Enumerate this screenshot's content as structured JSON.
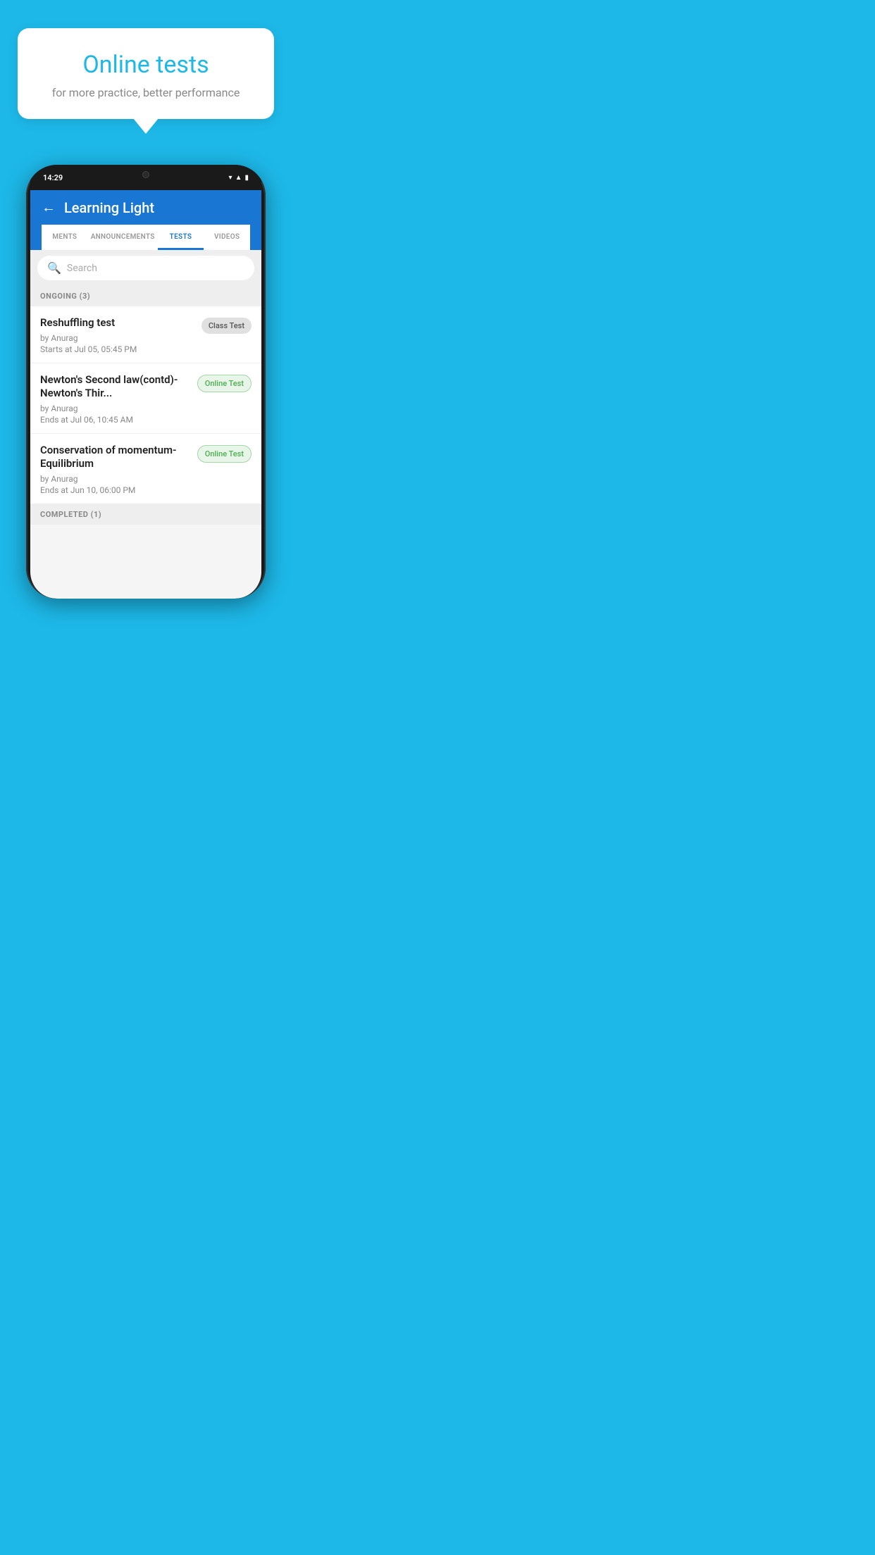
{
  "background_color": "#1DB8E8",
  "bubble": {
    "title": "Online tests",
    "subtitle": "for more practice, better performance"
  },
  "phone": {
    "status_bar": {
      "time": "14:29",
      "icons": [
        "wifi",
        "signal",
        "battery"
      ]
    },
    "header": {
      "title": "Learning Light",
      "back_label": "←"
    },
    "tabs": [
      {
        "label": "MENTS",
        "active": false
      },
      {
        "label": "ANNOUNCEMENTS",
        "active": false
      },
      {
        "label": "TESTS",
        "active": true
      },
      {
        "label": "VIDEOS",
        "active": false
      }
    ],
    "search": {
      "placeholder": "Search"
    },
    "ongoing_section": {
      "label": "ONGOING (3)"
    },
    "tests": [
      {
        "name": "Reshuffling test",
        "author": "by Anurag",
        "time_label": "Starts at",
        "time": "Jul 05, 05:45 PM",
        "badge": "Class Test",
        "badge_type": "class"
      },
      {
        "name": "Newton's Second law(contd)-Newton's Thir...",
        "author": "by Anurag",
        "time_label": "Ends at",
        "time": "Jul 06, 10:45 AM",
        "badge": "Online Test",
        "badge_type": "online"
      },
      {
        "name": "Conservation of momentum-Equilibrium",
        "author": "by Anurag",
        "time_label": "Ends at",
        "time": "Jun 10, 06:00 PM",
        "badge": "Online Test",
        "badge_type": "online"
      }
    ],
    "completed_section": {
      "label": "COMPLETED (1)"
    }
  }
}
